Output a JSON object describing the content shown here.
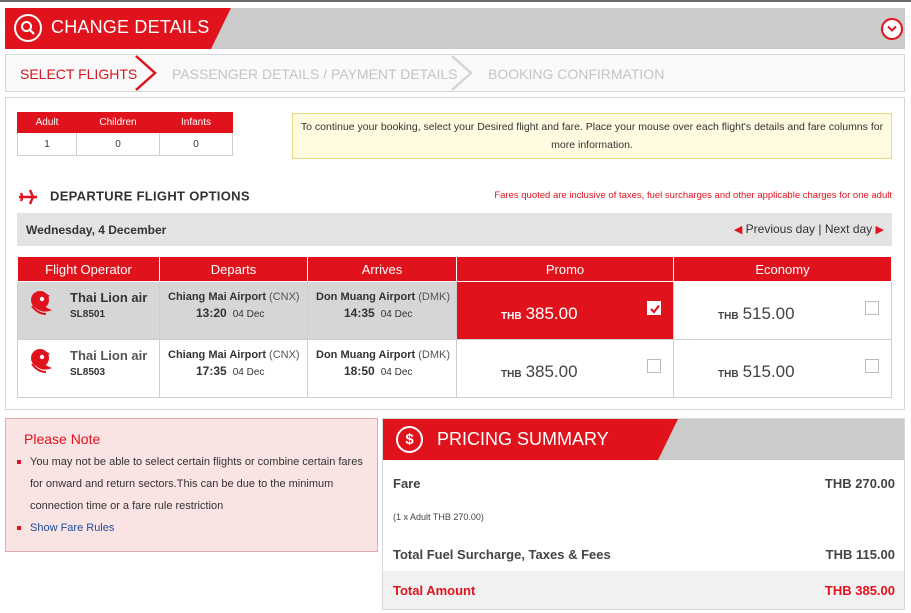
{
  "header": {
    "title": "CHANGE DETAILS",
    "search_icon": "search-icon",
    "collapse_icon": "chevron-down-icon"
  },
  "steps": [
    "SELECT FLIGHTS",
    "PASSENGER DETAILS / PAYMENT DETAILS",
    "BOOKING CONFIRMATION"
  ],
  "passengers": {
    "headers": [
      "Adult",
      "Children",
      "Infants"
    ],
    "values": [
      "1",
      "0",
      "0"
    ]
  },
  "notice": "To continue your booking, select your Desired flight and fare. Place your mouse over each flight's details and fare columns for more information.",
  "departure": {
    "title": "DEPARTURE FLIGHT OPTIONS",
    "fares_note": "Fares quoted are inclusive of taxes, fuel surcharges and other applicable charges for one adult",
    "date": "Wednesday, 4 December",
    "prev_day": "Previous day",
    "separator": "|",
    "next_day": "Next day"
  },
  "flights_table": {
    "headers": [
      "Flight Operator",
      "Departs",
      "Arrives",
      "Promo",
      "Economy"
    ],
    "rows": [
      {
        "operator": "Thai Lion air",
        "code": "SL8501",
        "dep_airport": "Chiang Mai Airport",
        "dep_code": "(CNX)",
        "dep_time": "13:20",
        "dep_date": "04 Dec",
        "arr_airport": "Don Muang Airport",
        "arr_code": "(DMK)",
        "arr_time": "14:35",
        "arr_date": "04 Dec",
        "promo_currency": "THB",
        "promo_price": "385.00",
        "economy_currency": "THB",
        "economy_price": "515.00"
      },
      {
        "operator": "Thai Lion air",
        "code": "SL8503",
        "dep_airport": "Chiang Mai Airport",
        "dep_code": "(CNX)",
        "dep_time": "17:35",
        "dep_date": "04 Dec",
        "arr_airport": "Don Muang Airport",
        "arr_code": "(DMK)",
        "arr_time": "18:50",
        "arr_date": "04 Dec",
        "promo_currency": "THB",
        "promo_price": "385.00",
        "economy_currency": "THB",
        "economy_price": "515.00"
      }
    ]
  },
  "please_note": {
    "title": "Please Note",
    "text": "You may not be able to select certain flights or combine certain fares for onward and return sectors.This can be due to the minimum connection time or a fare rule restriction",
    "link": "Show Fare Rules"
  },
  "pricing": {
    "title": "PRICING SUMMARY",
    "fare_label": "Fare",
    "fare_value": "THB 270.00",
    "fare_sub": "(1 x Adult THB 270.00)",
    "taxes_label": "Total Fuel Surcharge, Taxes & Fees",
    "taxes_value": "THB 115.00",
    "total_label": "Total Amount",
    "total_value": "THB 385.00"
  },
  "colors": {
    "accent": "#e0131d",
    "header_gray": "#cbcbcb"
  }
}
